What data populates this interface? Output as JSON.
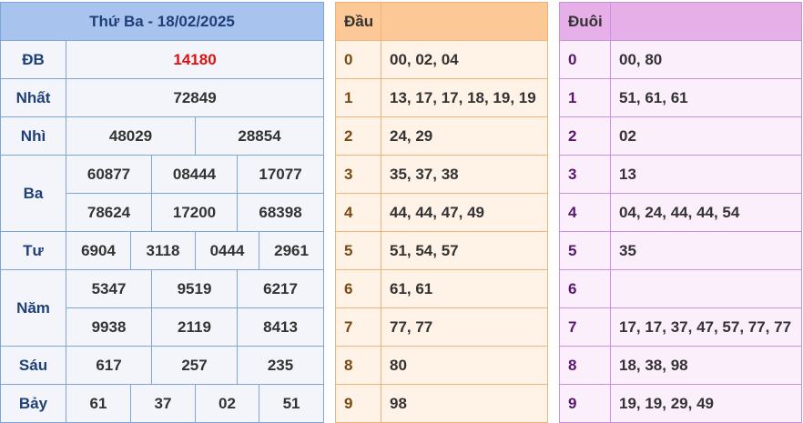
{
  "results": {
    "title": "Thứ Ba - 18/02/2025",
    "db": {
      "label": "ĐB",
      "values": [
        "14180"
      ]
    },
    "nhat": {
      "label": "Nhất",
      "values": [
        "72849"
      ]
    },
    "nhi": {
      "label": "Nhì",
      "values": [
        "48029",
        "28854"
      ]
    },
    "ba": {
      "label": "Ba",
      "values": [
        "60877",
        "08444",
        "17077",
        "78624",
        "17200",
        "68398"
      ]
    },
    "tu": {
      "label": "Tư",
      "values": [
        "6904",
        "3118",
        "0444",
        "2961"
      ]
    },
    "nam": {
      "label": "Năm",
      "values": [
        "5347",
        "9519",
        "6217",
        "9938",
        "2119",
        "8413"
      ]
    },
    "sau": {
      "label": "Sáu",
      "values": [
        "617",
        "257",
        "235"
      ]
    },
    "bay": {
      "label": "Bảy",
      "values": [
        "61",
        "37",
        "02",
        "51"
      ]
    }
  },
  "dau": {
    "header": "Đầu",
    "rows": [
      {
        "digit": "0",
        "values": "00, 02, 04"
      },
      {
        "digit": "1",
        "values": "13, 17, 17, 18, 19, 19"
      },
      {
        "digit": "2",
        "values": "24, 29"
      },
      {
        "digit": "3",
        "values": "35, 37, 38"
      },
      {
        "digit": "4",
        "values": "44, 44, 47, 49"
      },
      {
        "digit": "5",
        "values": "51, 54, 57"
      },
      {
        "digit": "6",
        "values": "61, 61"
      },
      {
        "digit": "7",
        "values": "77, 77"
      },
      {
        "digit": "8",
        "values": "80"
      },
      {
        "digit": "9",
        "values": "98"
      }
    ]
  },
  "duoi": {
    "header": "Đuôi",
    "rows": [
      {
        "digit": "0",
        "values": "00, 80"
      },
      {
        "digit": "1",
        "values": "51, 61, 61"
      },
      {
        "digit": "2",
        "values": "02"
      },
      {
        "digit": "3",
        "values": "13"
      },
      {
        "digit": "4",
        "values": "04, 24, 44, 44, 54"
      },
      {
        "digit": "5",
        "values": "35"
      },
      {
        "digit": "6",
        "values": ""
      },
      {
        "digit": "7",
        "values": "17, 17, 37, 47, 57, 77, 77"
      },
      {
        "digit": "8",
        "values": "18, 38, 98"
      },
      {
        "digit": "9",
        "values": "19, 19, 29, 49"
      }
    ]
  }
}
